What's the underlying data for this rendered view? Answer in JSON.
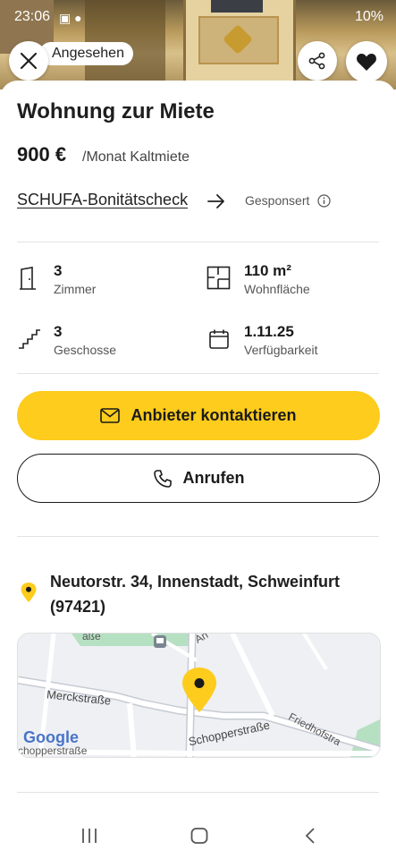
{
  "status_bar": {
    "time": "23:06",
    "icons": "▣ ●",
    "battery": "10%"
  },
  "header": {
    "seen_label": "Angesehen"
  },
  "listing": {
    "title": "Wohnung zur Miete",
    "price": "900 €",
    "price_unit": "/Monat Kaltmiete",
    "schufa_link": "SCHUFA-Bonitätscheck",
    "sponsored": "Gesponsert"
  },
  "stats": [
    {
      "value": "3",
      "label": "Zimmer",
      "icon": "door-icon"
    },
    {
      "value": "110 m²",
      "label": "Wohnfläche",
      "icon": "floorplan-icon"
    },
    {
      "value": "3",
      "label": "Geschosse",
      "icon": "stairs-icon"
    },
    {
      "value": "1.11.25",
      "label": "Verfügbarkeit",
      "icon": "calendar-icon"
    }
  ],
  "actions": {
    "contact": "Anbieter kontaktieren",
    "call": "Anrufen"
  },
  "location": {
    "address": "Neutorstr. 34, Innenstadt, Schweinfurt (97421)",
    "map_labels": {
      "street_top": "aße",
      "street_an": "An",
      "merck": "Merckstraße",
      "schopper": "Schopperstraße",
      "schopper_bottom": "chopperstraße",
      "friedhof": "Friedhofstra",
      "google": "Google"
    }
  },
  "colors": {
    "accent": "#fdcc1c",
    "text": "#1a1a1a"
  }
}
